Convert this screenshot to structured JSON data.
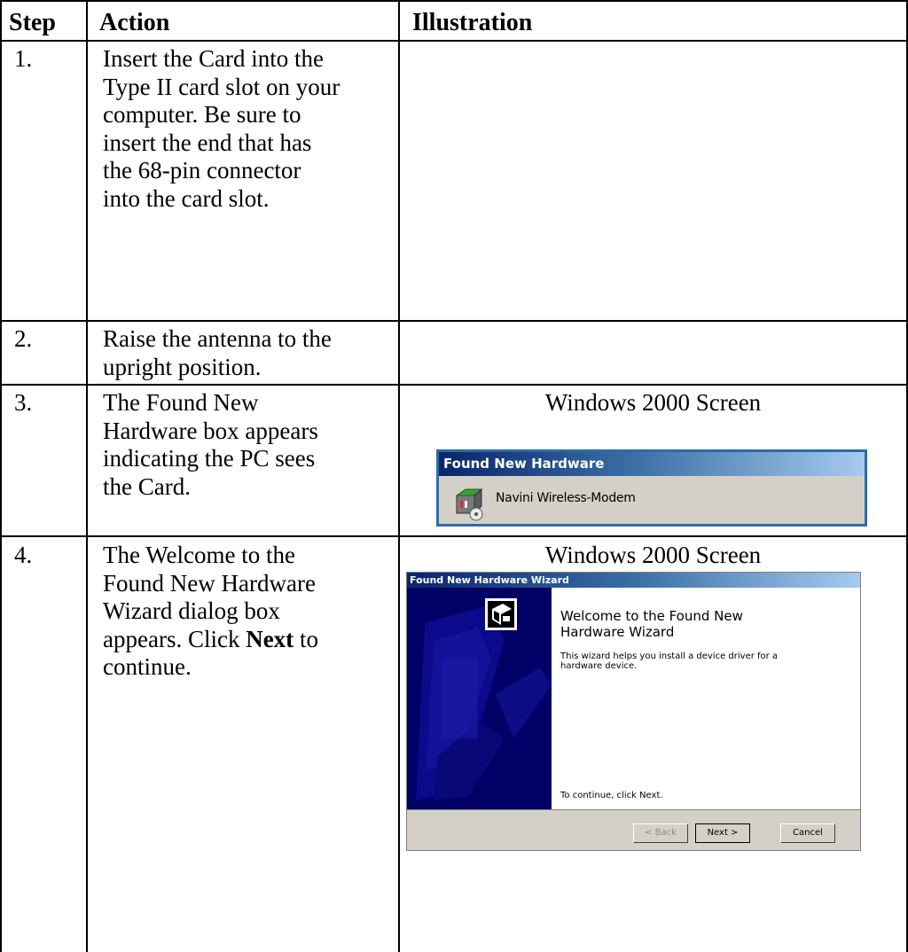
{
  "table": {
    "headers": {
      "step": "Step",
      "action": "Action",
      "illustration": "Illustration"
    },
    "rows": [
      {
        "step": "1.",
        "action_lines": [
          "Insert the Card into the",
          "Type II card slot on your",
          "computer. Be sure to",
          "insert the end that has",
          "the 68-pin connector",
          "into the card slot."
        ]
      },
      {
        "step": "2.",
        "action_lines": [
          "Raise the antenna to the",
          "upright position."
        ]
      },
      {
        "step": "3.",
        "action_lines": [
          "The Found New",
          "Hardware box appears",
          "indicating the PC sees",
          "the Card."
        ],
        "illustration_caption": "Windows 2000 Screen"
      },
      {
        "step": "4.",
        "action_lines": [
          "The Welcome to the",
          "Found New Hardware",
          "Wizard dialog box"
        ],
        "action_last_prefix": "appears. Click ",
        "action_last_bold": "Next",
        "action_last_suffix": " to",
        "action_final": "continue.",
        "illustration_caption": "Windows 2000 Screen"
      }
    ]
  },
  "found_new_hardware": {
    "title": "Found New Hardware",
    "device_name": "Navini Wireless-Modem",
    "icon": "hardware-device-icon"
  },
  "wizard": {
    "title": "Found New Hardware Wizard",
    "heading_line1": "Welcome to the Found New",
    "heading_line2": "Hardware Wizard",
    "description_line1": "This wizard helps you install a device driver for a",
    "description_line2": "hardware device.",
    "continue_text": "To continue, click Next.",
    "back_label": "< Back",
    "next_label": "Next >",
    "cancel_label": "Cancel",
    "icon": "wizard-hardware-icon"
  },
  "colors": {
    "titlebar_start": "#0a246a",
    "titlebar_end": "#a6caf0",
    "dialog_face": "#d4d0c8",
    "wizard_sidebar": "#000066",
    "balloon_border": "#2d6ba8"
  }
}
